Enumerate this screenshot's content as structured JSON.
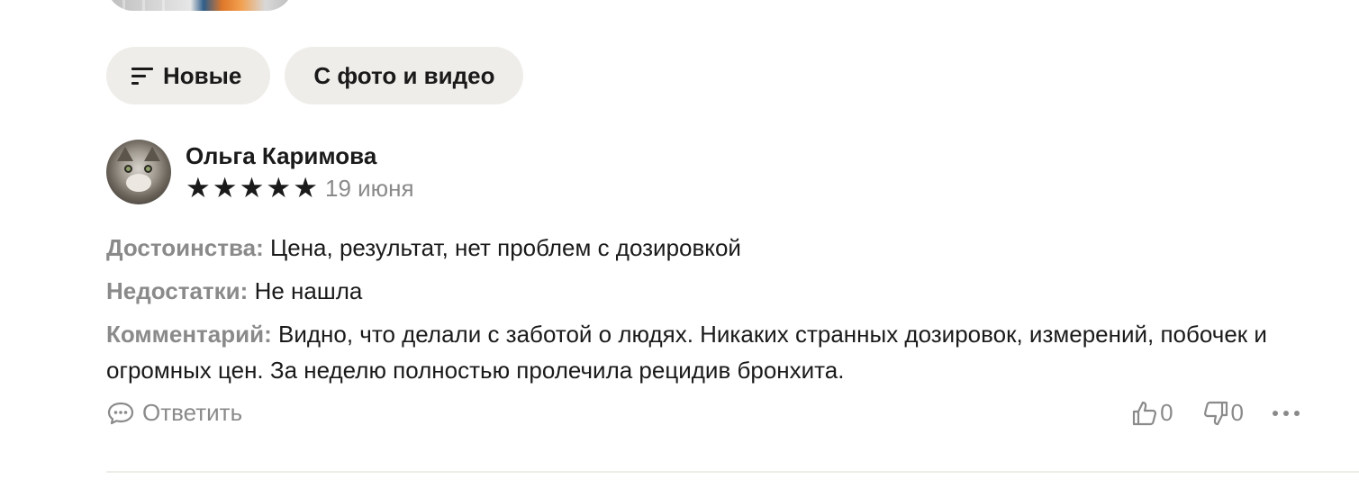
{
  "filters": {
    "sort_label": "Новые",
    "media_label": "С фото и видео"
  },
  "review": {
    "author": "Ольга Каримова",
    "rating": 5,
    "stars": [
      "★",
      "★",
      "★",
      "★",
      "★"
    ],
    "date": "19 июня",
    "pros_label": "Достоинства:",
    "pros_text": "Цена, результат, нет проблем с дозировкой",
    "cons_label": "Недостатки:",
    "cons_text": "Не нашла",
    "comment_label": "Комментарий:",
    "comment_text": "Видно, что делали с заботой о людях. Никаких странных дозировок, измерений, побочек и огромных цен. За неделю полностью пролечила рецидив бронхита."
  },
  "actions": {
    "reply_label": "Ответить",
    "likes": "0",
    "dislikes": "0"
  },
  "colors": {
    "chip_bg": "#efede9",
    "muted": "#8a8a8a",
    "text": "#1a1a1a"
  },
  "icons": [
    "sort-icon",
    "comment-icon",
    "thumbs-up-icon",
    "thumbs-down-icon",
    "more-icon"
  ]
}
